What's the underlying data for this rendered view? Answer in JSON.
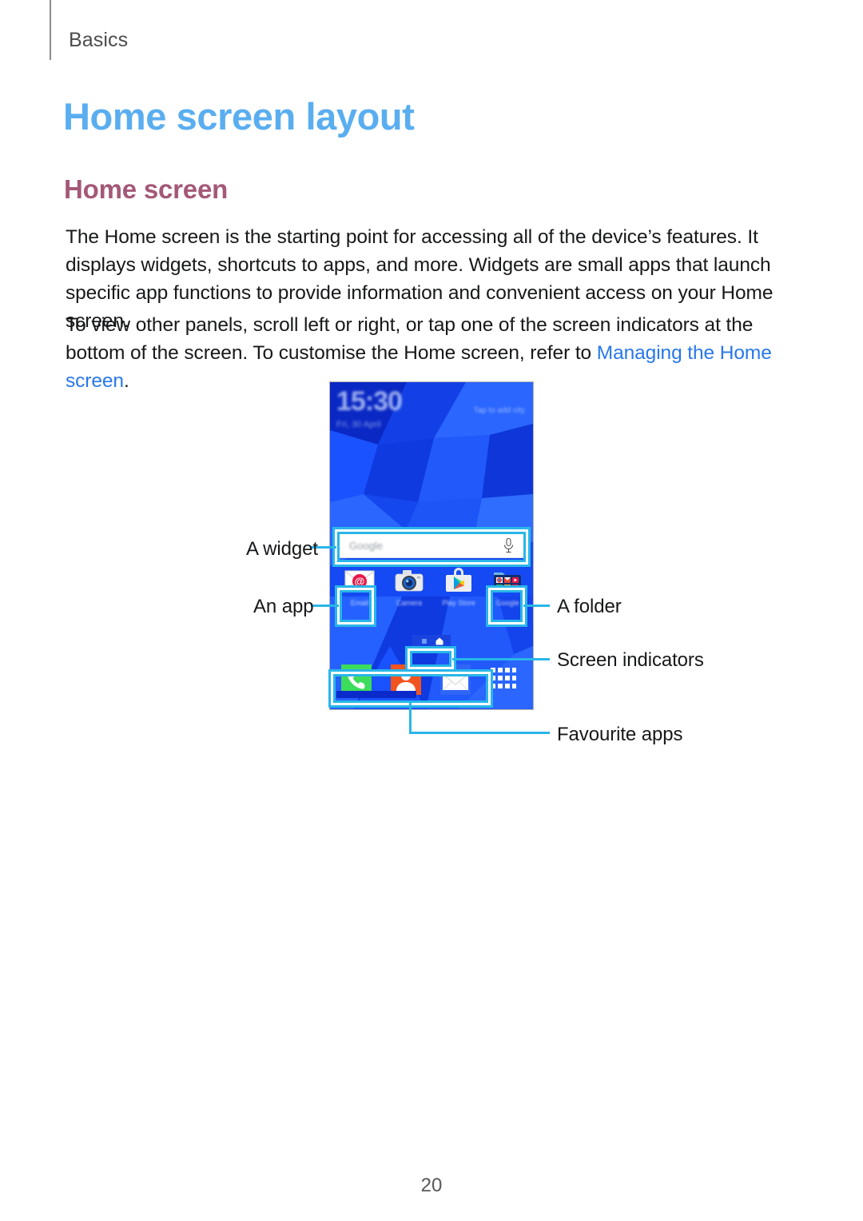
{
  "header": {
    "breadcrumb": "Basics"
  },
  "page_title": "Home screen layout",
  "section_title": "Home screen",
  "paragraphs": {
    "p1": "The Home screen is the starting point for accessing all of the device’s features. It displays widgets, shortcuts to apps, and more. Widgets are small apps that launch specific app functions to provide information and convenient access on your Home screen.",
    "p2_before": "To view other panels, scroll left or right, or tap one of the screen indicators at the bottom of the screen. To customise the Home screen, refer to ",
    "p2_link": "Managing the Home screen",
    "p2_after": "."
  },
  "figure": {
    "callouts": {
      "widget": "A widget",
      "app": "An app",
      "folder": "A folder",
      "indicators": "Screen indicators",
      "favourites": "Favourite apps"
    },
    "phone": {
      "clock_time": "15:30",
      "clock_date": "Fri, 30 April",
      "weather_hint": "Tap to add city",
      "search_placeholder": "Google",
      "apps": [
        {
          "label": "Email",
          "icon": "email-icon"
        },
        {
          "label": "Camera",
          "icon": "camera-icon"
        },
        {
          "label": "Play Store",
          "icon": "play-store-icon"
        },
        {
          "label": "Google",
          "icon": "folder-icon"
        }
      ],
      "dock": [
        {
          "label": "Phone",
          "icon": "phone-icon"
        },
        {
          "label": "Contacts",
          "icon": "contacts-icon"
        },
        {
          "label": "Messages",
          "icon": "messages-icon"
        }
      ],
      "apps_grid_label": "Apps",
      "indicator_icons": [
        "panel-dot-icon",
        "home-panel-icon"
      ]
    }
  },
  "page_number": "20",
  "colors": {
    "title_blue": "#5aaef0",
    "section_mauve": "#a45877",
    "link_blue": "#2878ea",
    "callout_cyan": "#29b6e8",
    "wallpaper_blue": "#1247f2"
  }
}
